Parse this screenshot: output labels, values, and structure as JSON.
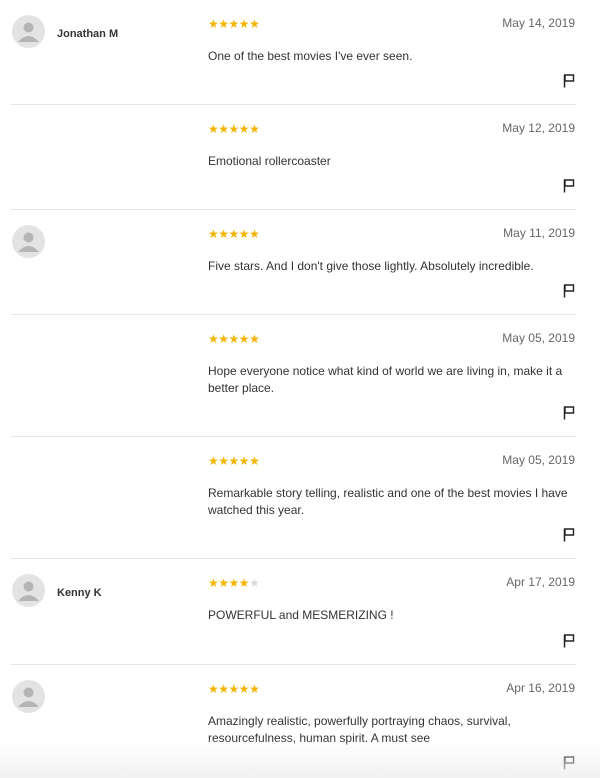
{
  "colors": {
    "star_filled": "#f5b400",
    "star_empty": "#d9d9d9",
    "avatar_bg": "#e3e3e3"
  },
  "reviews": [
    {
      "username": "Jonathan M",
      "avatar": true,
      "rating": 5,
      "date": "May 14, 2019",
      "text": "One of the best movies I've ever seen."
    },
    {
      "username": "",
      "avatar": false,
      "rating": 5,
      "date": "May 12, 2019",
      "text": "Emotional rollercoaster"
    },
    {
      "username": "",
      "avatar": true,
      "rating": 5,
      "date": "May 11, 2019",
      "text": "Five stars. And I don't give those lightly. Absolutely incredible."
    },
    {
      "username": "",
      "avatar": false,
      "rating": 5,
      "date": "May 05, 2019",
      "text": "Hope everyone notice what kind of world we are living in, make it a better place."
    },
    {
      "username": "",
      "avatar": false,
      "rating": 5,
      "date": "May 05, 2019",
      "text": "Remarkable story telling, realistic and one of the best movies I have watched this year."
    },
    {
      "username": "Kenny K",
      "avatar": true,
      "rating": 4,
      "date": "Apr 17, 2019",
      "text": "POWERFUL and MESMERIZING !"
    },
    {
      "username": "",
      "avatar": true,
      "rating": 5,
      "date": "Apr 16, 2019",
      "text": "Amazingly realistic, powerfully portraying chaos, survival, resourcefulness, human spirit. A must see"
    }
  ]
}
